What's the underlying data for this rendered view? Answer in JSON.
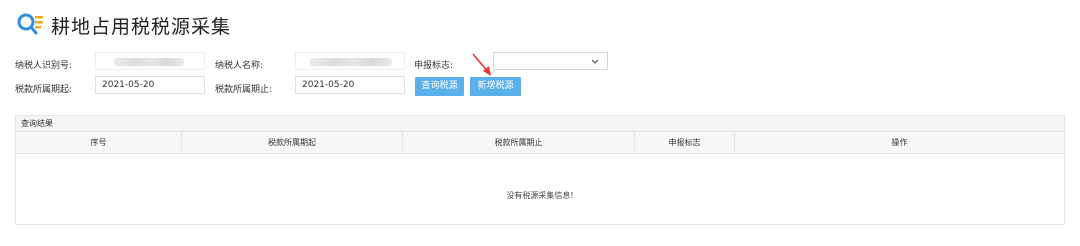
{
  "header": {
    "title": "耕地占用税税源采集",
    "logo_icon": "magnifier-list-icon"
  },
  "form": {
    "taxpayer_id_label": "纳税人识别号:",
    "taxpayer_name_label": "纳税人名称:",
    "declare_flag_label": "申报标志:",
    "period_start_label": "税款所属期起:",
    "period_start_value": "2021-05-20",
    "period_end_label": "税款所属期止:",
    "period_end_value": "2021-05-20"
  },
  "buttons": {
    "query": "查询税源",
    "add": "新增税源"
  },
  "results": {
    "title": "查询结果",
    "columns": [
      "序号",
      "税款所属期起",
      "税款所属期止",
      "申报标志",
      "操作"
    ],
    "empty_message": "没有税源采集信息!"
  },
  "colors": {
    "button": "#5ab0e9",
    "logo_blue": "#2f8fe0",
    "logo_orange": "#f5a623",
    "arrow": "#e53935"
  }
}
